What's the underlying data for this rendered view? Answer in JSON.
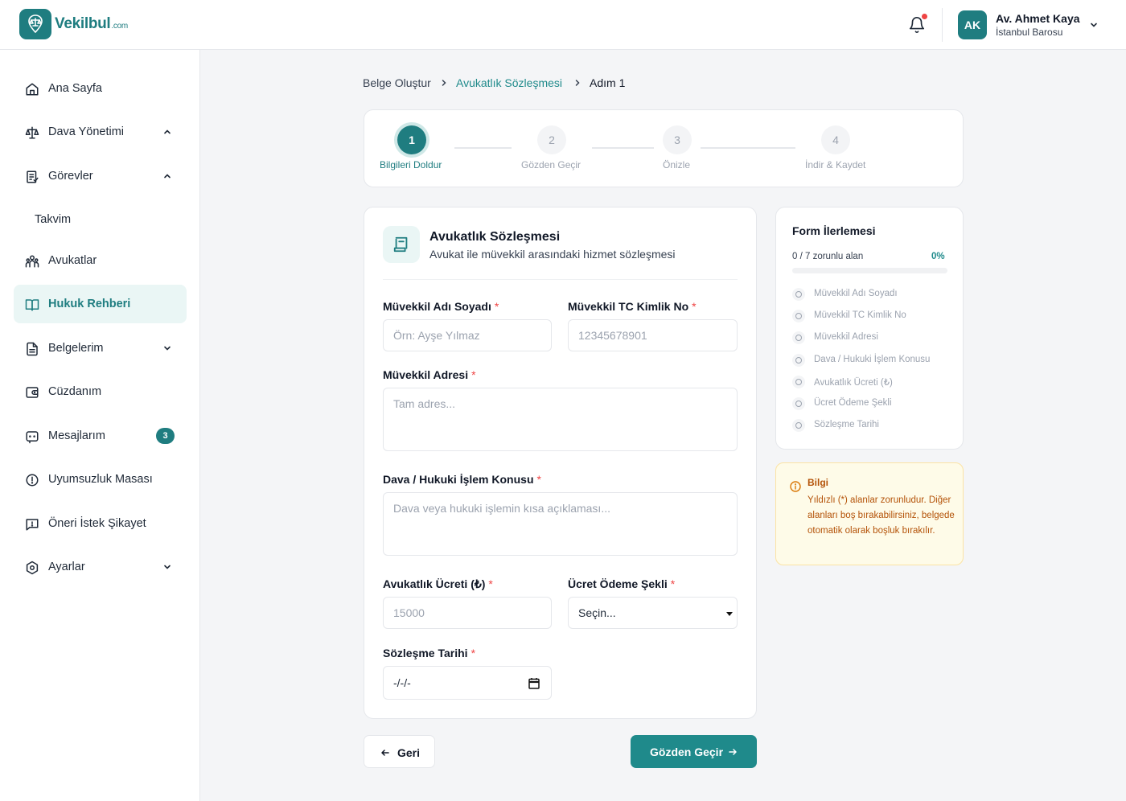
{
  "brand": {
    "name": "Vekilbul",
    "domain": ".com",
    "color": "#1f7d80"
  },
  "user": {
    "initials": "AK",
    "name": "Av. Ahmet Kaya",
    "organization": "İstanbul Barosu"
  },
  "sidebar": {
    "items": [
      {
        "label": "Ana Sayfa",
        "icon": "home-icon"
      },
      {
        "label": "Dava Yönetimi",
        "icon": "scale-icon",
        "chevron": "up"
      },
      {
        "label": "Görevler",
        "icon": "task-icon",
        "chevron": "up"
      },
      {
        "label": "Takvim",
        "sub": true
      },
      {
        "label": "Avukatlar",
        "icon": "users-icon"
      },
      {
        "label": "Hukuk Rehberi",
        "icon": "book-icon",
        "active": true
      },
      {
        "label": "Belgelerim",
        "icon": "document-icon",
        "chevron": "down"
      },
      {
        "label": "Cüzdanım",
        "icon": "wallet-icon"
      },
      {
        "label": "Mesajlarım",
        "icon": "message-icon",
        "badge": "3"
      },
      {
        "label": "Uyumsuzluk Masası",
        "icon": "alert-circle-icon"
      },
      {
        "label": "Öneri İstek Şikayet",
        "icon": "feedback-icon"
      },
      {
        "label": "Ayarlar",
        "icon": "settings-icon",
        "chevron": "down"
      }
    ]
  },
  "breadcrumb": {
    "root": "Belge Oluştur",
    "section": "Avukatlık Sözleşmesi",
    "current": "Adım 1"
  },
  "stepper": [
    {
      "number": "1",
      "label": "Bilgileri Doldur",
      "active": true
    },
    {
      "number": "2",
      "label": "Gözden Geçir"
    },
    {
      "number": "3",
      "label": "Önizle"
    },
    {
      "number": "4",
      "label": "İndir & Kaydet"
    }
  ],
  "form": {
    "title": "Avukatlık Sözleşmesi",
    "subtitle": "Avukat ile müvekkil arasındaki hizmet sözleşmesi",
    "fields": {
      "client_name": {
        "label": "Müvekkil Adı Soyadı",
        "placeholder": "Örn: Ayşe Yılmaz"
      },
      "client_tc": {
        "label": "Müvekkil TC Kimlik No",
        "placeholder": "12345678901"
      },
      "client_address": {
        "label": "Müvekkil Adresi",
        "placeholder": "Tam adres..."
      },
      "case_subject": {
        "label": "Dava / Hukuki İşlem Konusu",
        "placeholder": "Dava veya hukuki işlemin kısa açıklaması..."
      },
      "fee": {
        "label": "Avukatlık Ücreti (₺)",
        "placeholder": "15000"
      },
      "payment_method": {
        "label": "Ücret Ödeme Şekli",
        "value": "Seçin..."
      },
      "contract_date": {
        "label": "Sözleşme Tarihi",
        "value": "-/-/-"
      }
    },
    "required_mark": "*"
  },
  "buttons": {
    "back": "Geri",
    "next": "Gözden Geçir"
  },
  "progress": {
    "title": "Form İlerlemesi",
    "count_text": "0 / 7 zorunlu alan",
    "percent_text": "0%",
    "percent": 0,
    "items": [
      "Müvekkil Adı Soyadı",
      "Müvekkil TC Kimlik No",
      "Müvekkil Adresi",
      "Dava / Hukuki İşlem Konusu",
      "Avukatlık Ücreti (₺)",
      "Ücret Ödeme Şekli",
      "Sözleşme Tarihi"
    ]
  },
  "info": {
    "title": "Bilgi",
    "text": "Yıldızlı (*) alanlar zorunludur. Diğer alanları boş bırakabilirsiniz, belgede otomatik olarak boşluk bırakılır."
  }
}
